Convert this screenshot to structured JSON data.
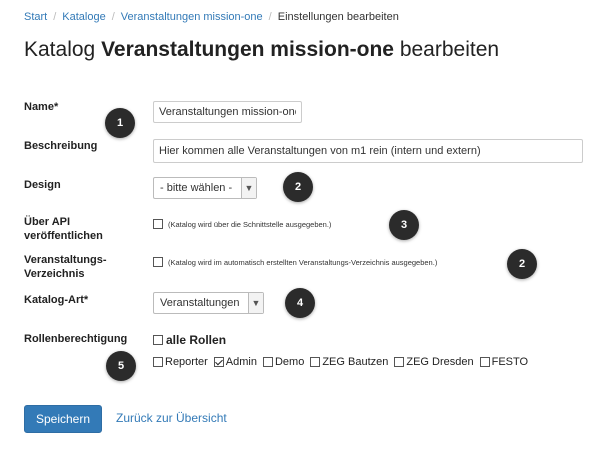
{
  "breadcrumb": {
    "items": [
      "Start",
      "Kataloge",
      "Veranstaltungen mission-one"
    ],
    "active": "Einstellungen bearbeiten",
    "separator": "/"
  },
  "title": {
    "prefix": "Katalog",
    "name": "Veranstaltungen mission-one",
    "suffix": "bearbeiten"
  },
  "form": {
    "name_label": "Name*",
    "name_value": "Veranstaltungen mission-one",
    "description_label": "Beschreibung",
    "description_value": "Hier kommen alle Veranstaltungen von m1 rein (intern und extern)",
    "design_label": "Design",
    "design_selected": "- bitte wählen -",
    "api_label_line1": "Über API",
    "api_label_line2": "veröffentlichen",
    "api_checkbox_text": "(Katalog wird über die Schnittstelle ausgegeben.)",
    "directory_label_line1": "Veranstaltungs-",
    "directory_label_line2": "Verzeichnis",
    "directory_checkbox_text": "(Katalog wird im automatisch erstellten Veranstaltungs-Verzeichnis ausgegeben.)",
    "type_label": "Katalog-Art*",
    "type_selected": "Veranstaltungen",
    "roles_label": "Rollenberechtigung",
    "all_roles_label": "alle Rollen",
    "roles": [
      {
        "label": "Reporter",
        "checked": false
      },
      {
        "label": "Admin",
        "checked": true
      },
      {
        "label": "Demo",
        "checked": false
      },
      {
        "label": "ZEG Bautzen",
        "checked": false
      },
      {
        "label": "ZEG Dresden",
        "checked": false
      },
      {
        "label": "FESTO",
        "checked": false
      }
    ]
  },
  "badges": [
    "1",
    "2",
    "3",
    "2",
    "4",
    "5"
  ],
  "actions": {
    "save_label": "Speichern",
    "back_label": "Zurück zur Übersicht"
  },
  "colors": {
    "link": "#337ab7",
    "primary_button": "#337ab7",
    "badge": "#2b2b2b"
  }
}
